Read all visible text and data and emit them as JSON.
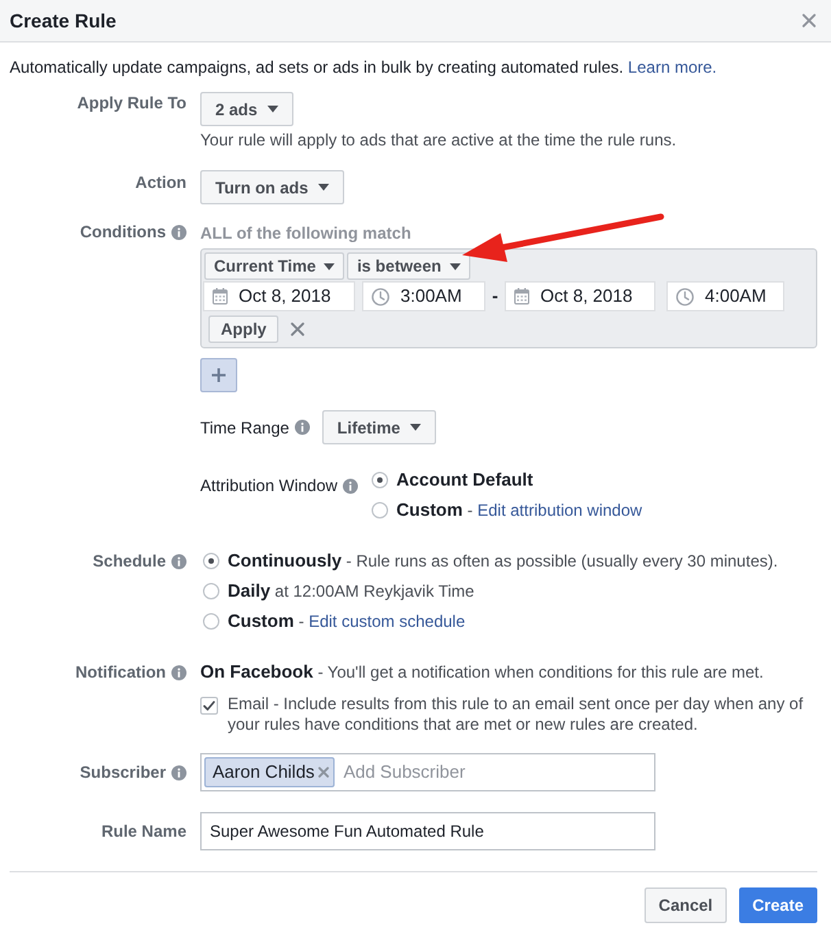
{
  "dialog": {
    "title": "Create Rule"
  },
  "intro": {
    "text": "Automatically update campaigns, ad sets or ads in bulk by creating automated rules.",
    "link": "Learn more."
  },
  "apply_rule_to": {
    "label": "Apply Rule To",
    "value": "2 ads",
    "help": "Your rule will apply to ads that are active at the time the rule runs."
  },
  "action": {
    "label": "Action",
    "value": "Turn on ads"
  },
  "conditions": {
    "label": "Conditions",
    "info": true,
    "summary": "ALL of the following match",
    "metric": "Current Time",
    "operator": "is between",
    "start_date": "Oct 8, 2018",
    "start_time": "3:00AM",
    "separator": "-",
    "end_date": "Oct 8, 2018",
    "end_time": "4:00AM",
    "apply": "Apply"
  },
  "time_range": {
    "label": "Time Range",
    "info": true,
    "value": "Lifetime"
  },
  "attribution_window": {
    "label": "Attribution Window",
    "info": true,
    "options": [
      {
        "label": "Account Default",
        "selected": true
      },
      {
        "label": "Custom",
        "description": "-",
        "link": "Edit attribution window",
        "selected": false
      }
    ]
  },
  "schedule": {
    "label": "Schedule",
    "info": true,
    "options": [
      {
        "label": "Continuously",
        "description": "- Rule runs as often as possible (usually every 30 minutes).",
        "selected": true
      },
      {
        "label": "Daily",
        "description": "at 12:00AM Reykjavik Time",
        "selected": false
      },
      {
        "label": "Custom",
        "description": "-",
        "link": "Edit custom schedule",
        "selected": false
      }
    ]
  },
  "notification": {
    "label": "Notification",
    "info": true,
    "channel": "On Facebook",
    "text": "- You'll get a notification when conditions for this rule are met.",
    "email": {
      "checked": true,
      "text": "Email - Include results from this rule to an email sent once per day when any of your rules have conditions that are met or new rules are created."
    }
  },
  "subscriber": {
    "label": "Subscriber",
    "info": true,
    "tokens": [
      "Aaron Childs"
    ],
    "placeholder": "Add Subscriber"
  },
  "rule_name": {
    "label": "Rule Name",
    "value": "Super Awesome Fun Automated Rule"
  },
  "footer_buttons": [
    {
      "label": "Cancel",
      "kind": "secondary"
    },
    {
      "label": "Create",
      "kind": "primary"
    }
  ]
}
